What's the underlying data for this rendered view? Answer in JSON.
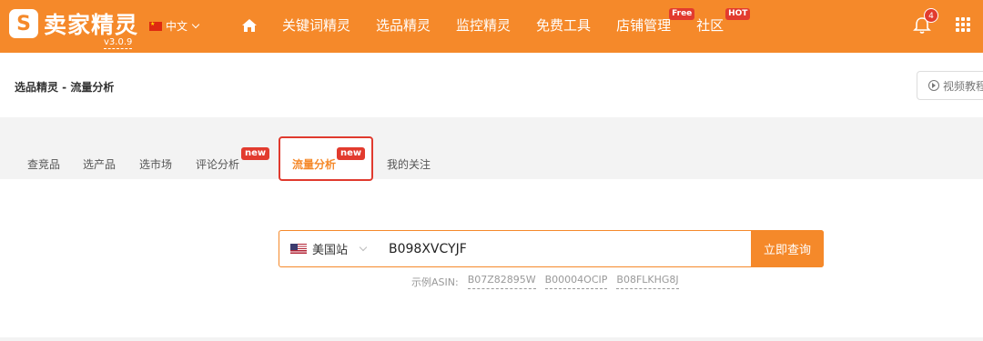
{
  "header": {
    "logo_mark": "S",
    "logo_text": "卖家精灵",
    "version": "v3.0.9",
    "language": "中文",
    "nav": [
      {
        "label": "关键词精灵",
        "badge": ""
      },
      {
        "label": "选品精灵",
        "badge": ""
      },
      {
        "label": "监控精灵",
        "badge": ""
      },
      {
        "label": "免费工具",
        "badge": ""
      },
      {
        "label": "店铺管理",
        "badge": "Free"
      },
      {
        "label": "社区",
        "badge": "HOT"
      }
    ],
    "notification_count": "4",
    "accent_color": "#f5892a"
  },
  "breadcrumb": "选品精灵 - 流量分析",
  "video_button": "视频教程",
  "tabs": [
    {
      "label": "查竞品",
      "badge": ""
    },
    {
      "label": "选产品",
      "badge": ""
    },
    {
      "label": "选市场",
      "badge": ""
    },
    {
      "label": "评论分析",
      "badge": "new"
    },
    {
      "label": "流量分析",
      "badge": "new",
      "active": true
    },
    {
      "label": "我的关注",
      "badge": ""
    }
  ],
  "search": {
    "site": "美国站",
    "value": "B098XVCYJF",
    "button": "立即查询"
  },
  "examples": {
    "label": "示例ASIN:",
    "items": [
      "B07Z82895W",
      "B00004OCIP",
      "B08FLKHG8J"
    ]
  }
}
